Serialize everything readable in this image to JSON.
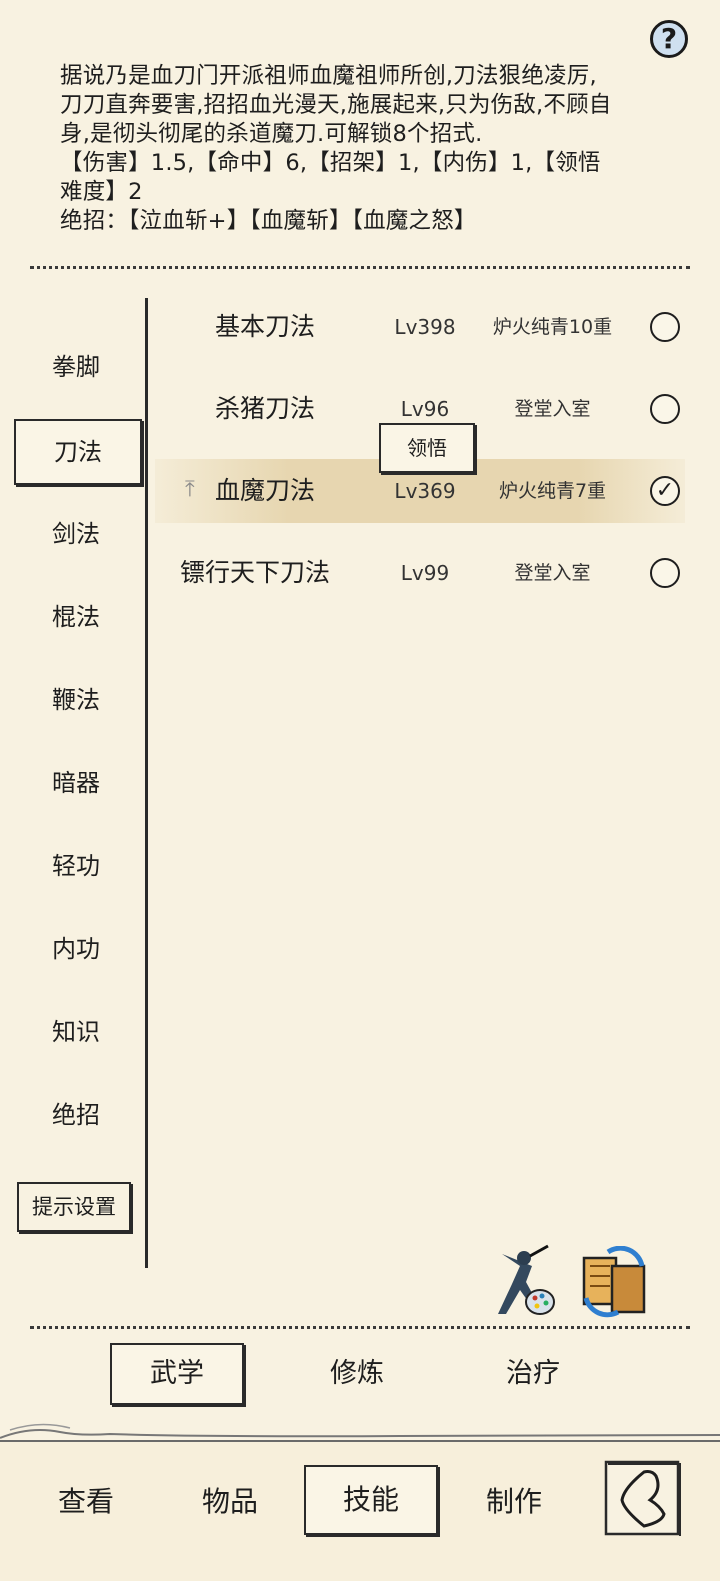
{
  "help_icon": "question-mark-icon",
  "description": {
    "lines": [
      "据说乃是血刀门开派祖师血魔祖师所创,刀法狠绝凌厉,",
      "刀刀直奔要害,招招血光漫天,施展起来,只为伤敌,不顾自",
      "身,是彻头彻尾的杀道魔刀.可解锁8个招式.",
      "【伤害】1.5,【命中】6,【招架】1,【内伤】1,【领悟",
      "难度】2",
      "绝招：【泣血斩+】【血魔斩】【血魔之怒】"
    ]
  },
  "categories": [
    "拳脚",
    "刀法",
    "剑法",
    "棍法",
    "鞭法",
    "暗器",
    "轻功",
    "内功",
    "知识",
    "绝招"
  ],
  "active_category": "刀法",
  "hint_settings_label": "提示设置",
  "skills": [
    {
      "name": "基本刀法",
      "level": "Lv398",
      "realm": "炉火纯青10重",
      "selected": false
    },
    {
      "name": "杀猪刀法",
      "level": "Lv96",
      "realm": "登堂入室",
      "selected": false
    },
    {
      "name": "血魔刀法",
      "level": "Lv369",
      "realm": "炉火纯青7重",
      "selected": true
    },
    {
      "name": "镖行天下刀法",
      "level": "Lv99",
      "realm": "登堂入室",
      "selected": false
    }
  ],
  "lingwu_label": "领悟",
  "sub_tabs": {
    "wuxue": "武学",
    "xiulian": "修炼",
    "zhiliao": "治疗"
  },
  "bottom_nav": {
    "chakan": "查看",
    "wupin": "物品",
    "jineng": "技能",
    "zhizuo": "制作"
  },
  "colors": {
    "background": "#f8f2e1",
    "selected_row": "#e1cda0",
    "ink": "#1e1e1e"
  }
}
